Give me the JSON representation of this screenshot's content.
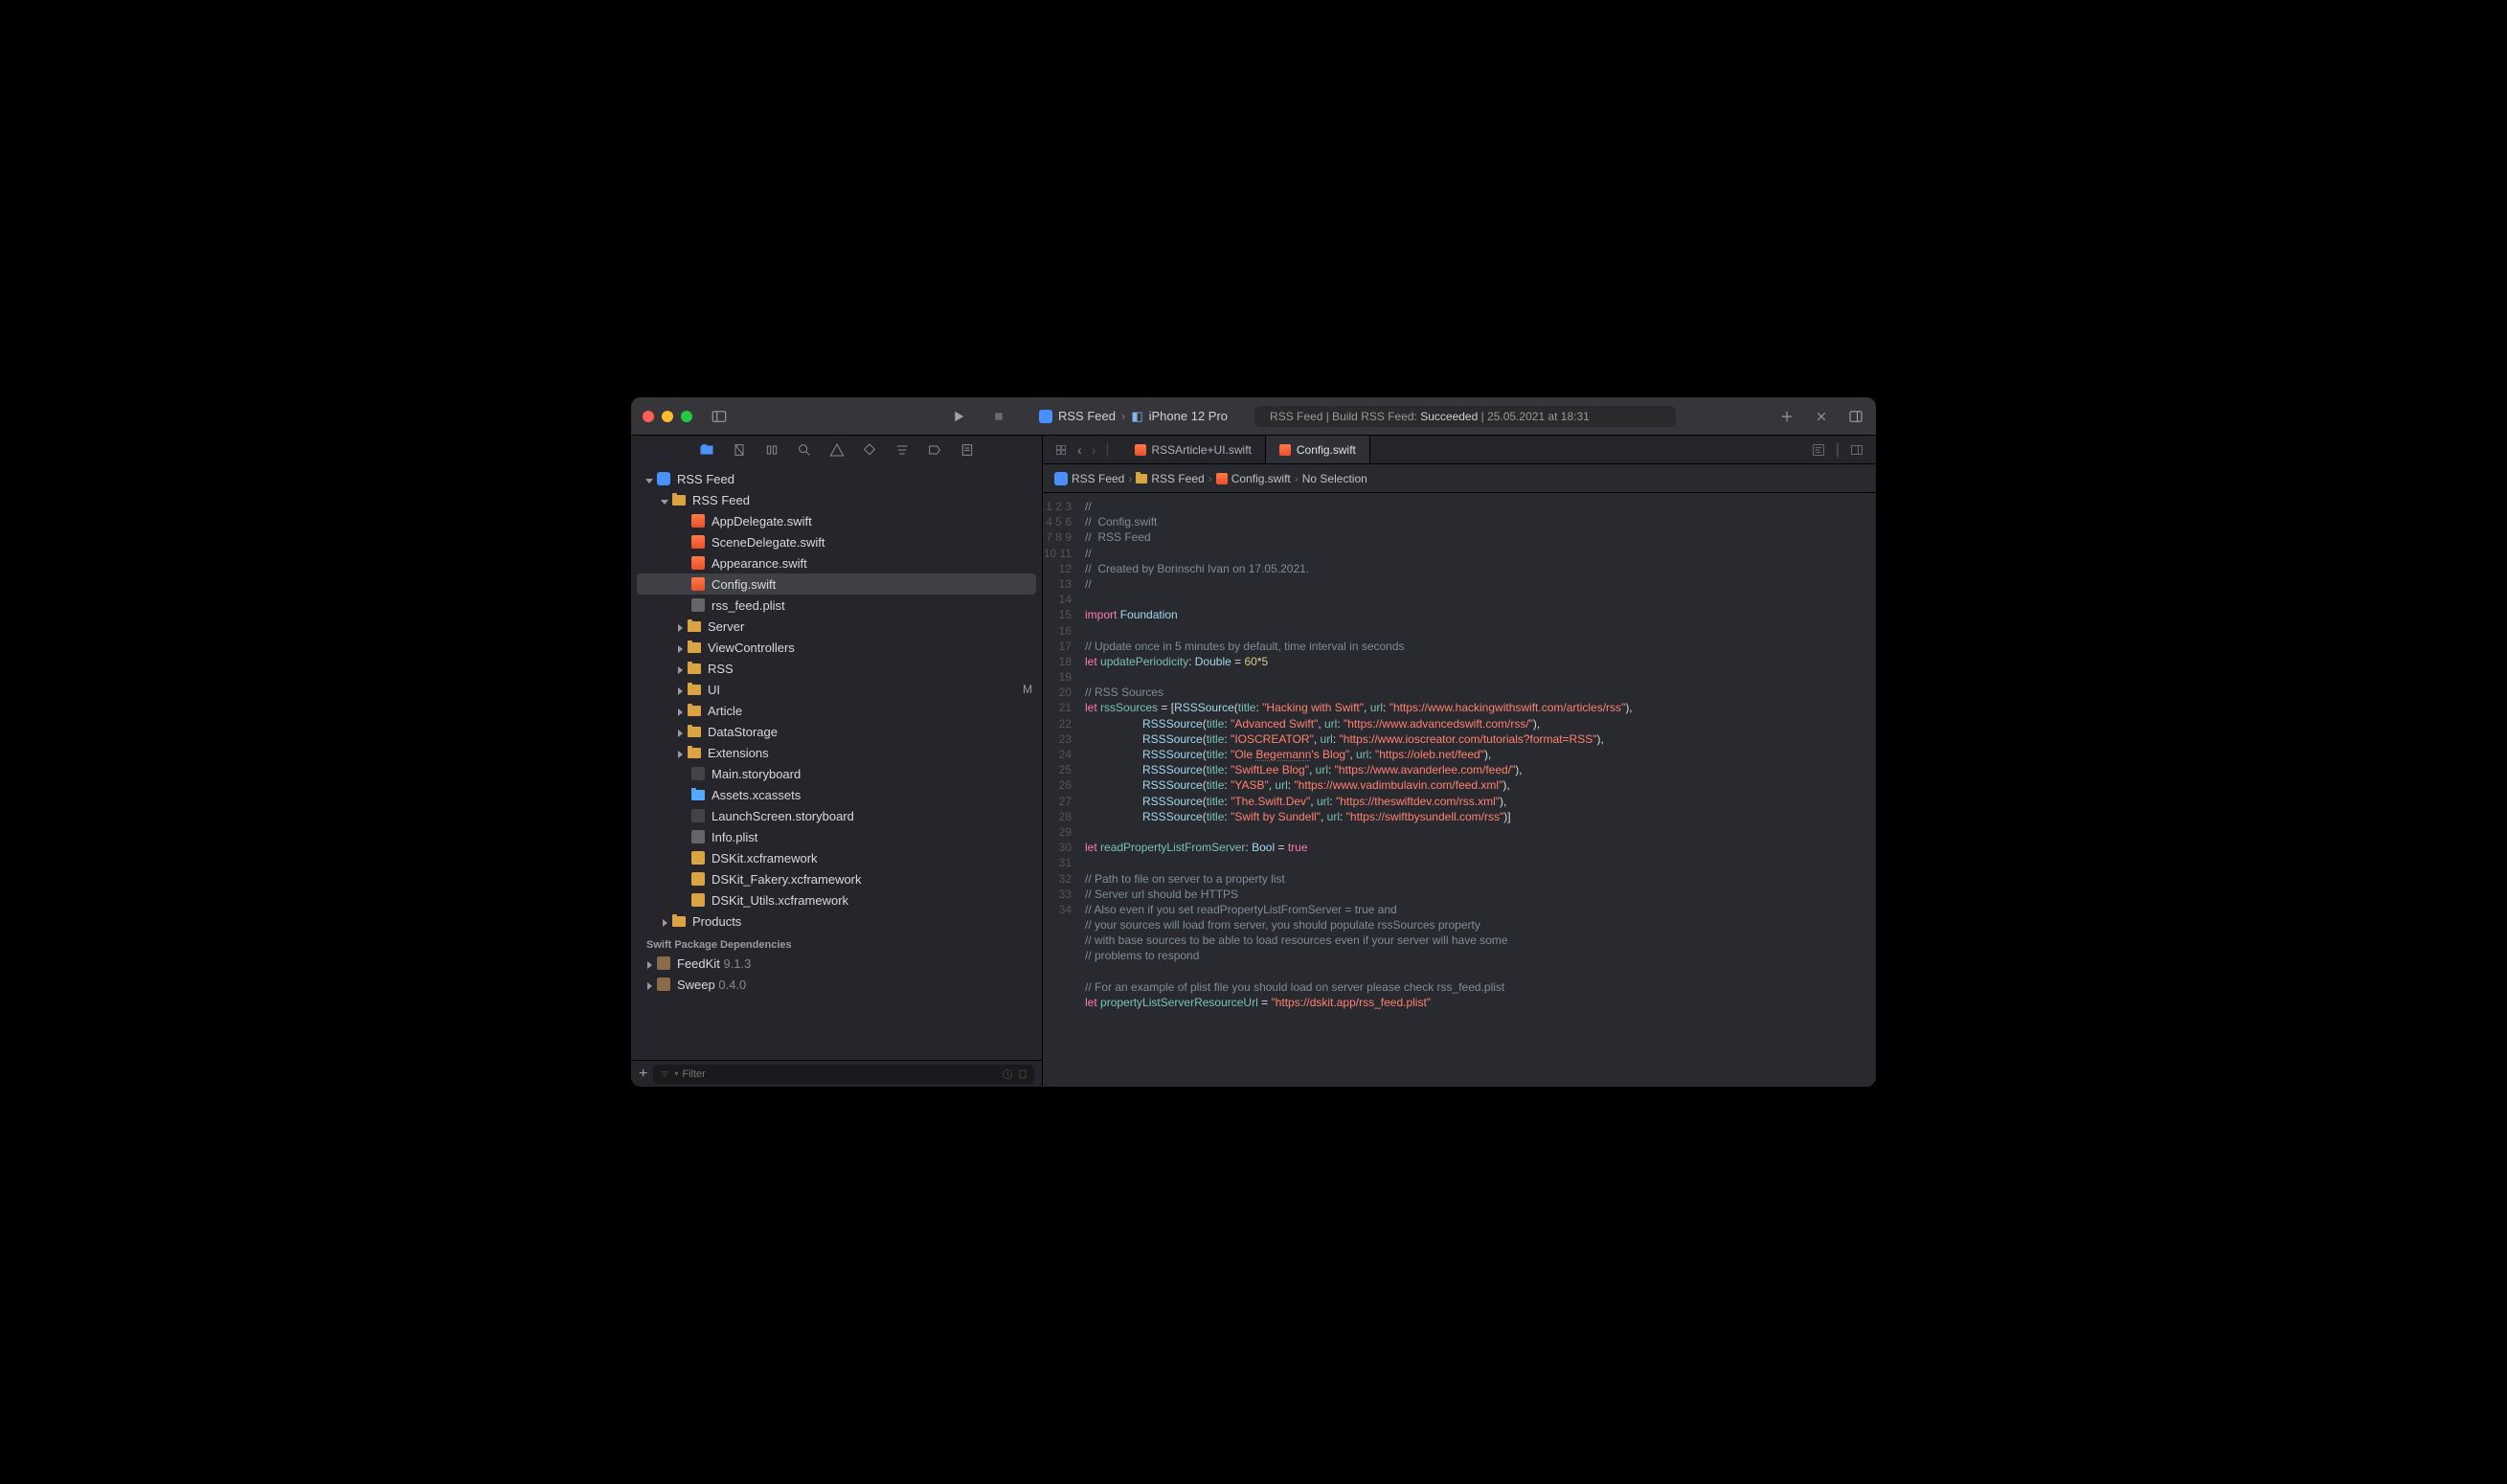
{
  "titlebar": {
    "scheme": "RSS Feed",
    "device": "iPhone 12 Pro",
    "status_prefix": "RSS Feed | Build RSS Feed: ",
    "status_result": "Succeeded",
    "status_suffix": " | 25.05.2021 at 18:31"
  },
  "tabs": {
    "t0": "RSSArticle+UI.swift",
    "t1": "Config.swift"
  },
  "jumpbar": {
    "p0": "RSS Feed",
    "p1": "RSS Feed",
    "p2": "Config.swift",
    "p3": "No Selection"
  },
  "sidebar": {
    "root": "RSS Feed",
    "group": "RSS Feed",
    "files": {
      "appdelegate": "AppDelegate.swift",
      "scenedelegate": "SceneDelegate.swift",
      "appearance": "Appearance.swift",
      "config": "Config.swift",
      "rssfeedplist": "rss_feed.plist",
      "server": "Server",
      "viewcontrollers": "ViewControllers",
      "rss": "RSS",
      "ui": "UI",
      "article": "Article",
      "datastorage": "DataStorage",
      "extensions": "Extensions",
      "mainstoryboard": "Main.storyboard",
      "assets": "Assets.xcassets",
      "launchscreen": "LaunchScreen.storyboard",
      "infoplist": "Info.plist",
      "dskit": "DSKit.xcframework",
      "dskitfakery": "DSKit_Fakery.xcframework",
      "dskitutils": "DSKit_Utils.xcframework",
      "products": "Products"
    },
    "ui_badge": "M",
    "deps_title": "Swift Package Dependencies",
    "deps": {
      "feedkit": "FeedKit",
      "feedkit_v": "9.1.3",
      "sweep": "Sweep",
      "sweep_v": "0.4.0"
    },
    "filter_placeholder": "Filter"
  },
  "code": {
    "lines": [
      "//",
      "//  Config.swift",
      "//  RSS Feed",
      "//",
      "//  Created by Borinschi Ivan on 17.05.2021.",
      "//",
      "",
      "import Foundation",
      "",
      "// Update once in 5 minutes by default, time interval in seconds",
      "let updatePeriodicity: Double = 60*5",
      "",
      "// RSS Sources",
      "let rssSources = [RSSSource(title: \"Hacking with Swift\", url: \"https://www.hackingwithswift.com/articles/rss\"),",
      "                  RSSSource(title: \"Advanced Swift\", url: \"https://www.advancedswift.com/rss/\"),",
      "                  RSSSource(title: \"IOSCREATOR\", url: \"https://www.ioscreator.com/tutorials?format=RSS\"),",
      "                  RSSSource(title: \"Ole Begemann's Blog\", url: \"https://oleb.net/feed\"),",
      "                  RSSSource(title: \"SwiftLee Blog\", url: \"https://www.avanderlee.com/feed/\"),",
      "                  RSSSource(title: \"YASB\", url: \"https://www.vadimbulavin.com/feed.xml\"),",
      "                  RSSSource(title: \"The.Swift.Dev\", url: \"https://theswiftdev.com/rss.xml\"),",
      "                  RSSSource(title: \"Swift by Sundell\", url: \"https://swiftbysundell.com/rss\")]",
      "",
      "let readPropertyListFromServer: Bool = true",
      "",
      "// Path to file on server to a property list",
      "// Server url should be HTTPS",
      "// Also even if you set readPropertyListFromServer = true and",
      "// your sources will load from server, you should populate rssSources property",
      "// with base sources to be able to load resources even if your server will have some",
      "// problems to respond",
      "",
      "// For an example of plist file you should load on server please check rss_feed.plist",
      "let propertyListServerResourceUrl = \"https://dskit.app/rss_feed.plist\"",
      ""
    ]
  }
}
